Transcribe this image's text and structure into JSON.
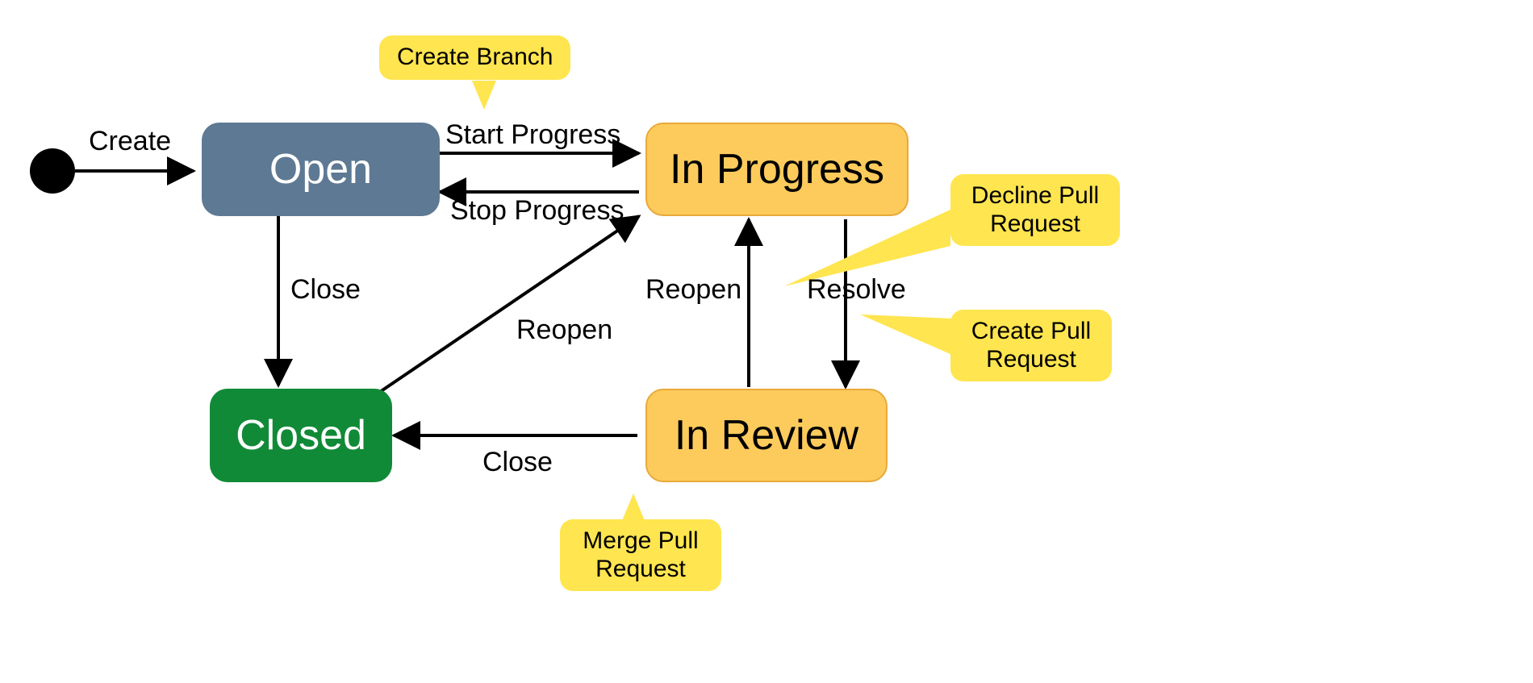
{
  "states": {
    "open": {
      "label": "Open"
    },
    "inProgress": {
      "label": "In Progress"
    },
    "inReview": {
      "label": "In Review"
    },
    "closed": {
      "label": "Closed"
    }
  },
  "transitions": {
    "create": {
      "label": "Create"
    },
    "startProgress": {
      "label": "Start Progress"
    },
    "stopProgress": {
      "label": "Stop Progress"
    },
    "close": {
      "label": "Close"
    },
    "closeReview": {
      "label": "Close"
    },
    "reopenClosed": {
      "label": "Reopen"
    },
    "reopenReview": {
      "label": "Reopen"
    },
    "resolve": {
      "label": "Resolve"
    }
  },
  "notes": {
    "createBranch": {
      "text": "Create Branch"
    },
    "declinePR": {
      "line1": "Decline Pull",
      "line2": "Request"
    },
    "createPR": {
      "line1": "Create Pull",
      "line2": "Request"
    },
    "mergePR": {
      "line1": "Merge Pull",
      "line2": "Request"
    }
  }
}
